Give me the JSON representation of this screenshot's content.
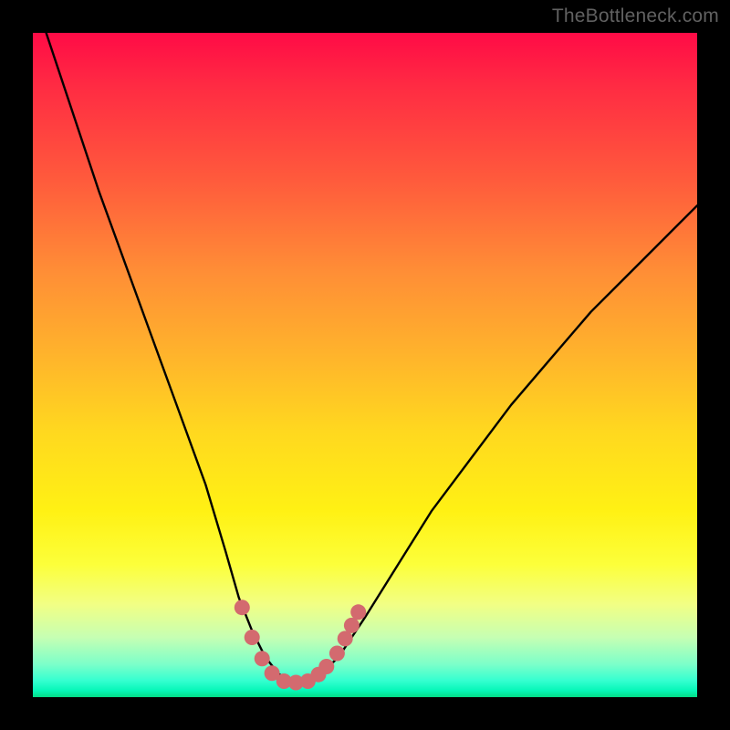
{
  "watermark": "TheBottleneck.com",
  "chart_data": {
    "type": "line",
    "title": "",
    "xlabel": "",
    "ylabel": "",
    "xlim": [
      0,
      100
    ],
    "ylim": [
      0,
      100
    ],
    "series": [
      {
        "name": "bottleneck-curve",
        "x": [
          2,
          6,
          10,
          14,
          18,
          22,
          26,
          29,
          31,
          33,
          35,
          37,
          39,
          41,
          43,
          46,
          50,
          55,
          60,
          66,
          72,
          78,
          84,
          90,
          96,
          100
        ],
        "y": [
          100,
          88,
          76,
          65,
          54,
          43,
          32,
          22,
          15,
          10,
          6,
          3.5,
          2.3,
          2.3,
          3.2,
          6,
          12,
          20,
          28,
          36,
          44,
          51,
          58,
          64,
          70,
          74
        ]
      }
    ],
    "markers": {
      "name": "highlight-dots",
      "color": "#d36a6f",
      "points": [
        {
          "x": 31.5,
          "y": 13.5
        },
        {
          "x": 33.0,
          "y": 9.0
        },
        {
          "x": 34.5,
          "y": 5.8
        },
        {
          "x": 36.0,
          "y": 3.6
        },
        {
          "x": 37.8,
          "y": 2.4
        },
        {
          "x": 39.6,
          "y": 2.2
        },
        {
          "x": 41.4,
          "y": 2.4
        },
        {
          "x": 43.0,
          "y": 3.4
        },
        {
          "x": 44.2,
          "y": 4.6
        },
        {
          "x": 45.8,
          "y": 6.6
        },
        {
          "x": 47.0,
          "y": 8.8
        },
        {
          "x": 48.0,
          "y": 10.8
        },
        {
          "x": 49.0,
          "y": 12.8
        }
      ]
    }
  }
}
